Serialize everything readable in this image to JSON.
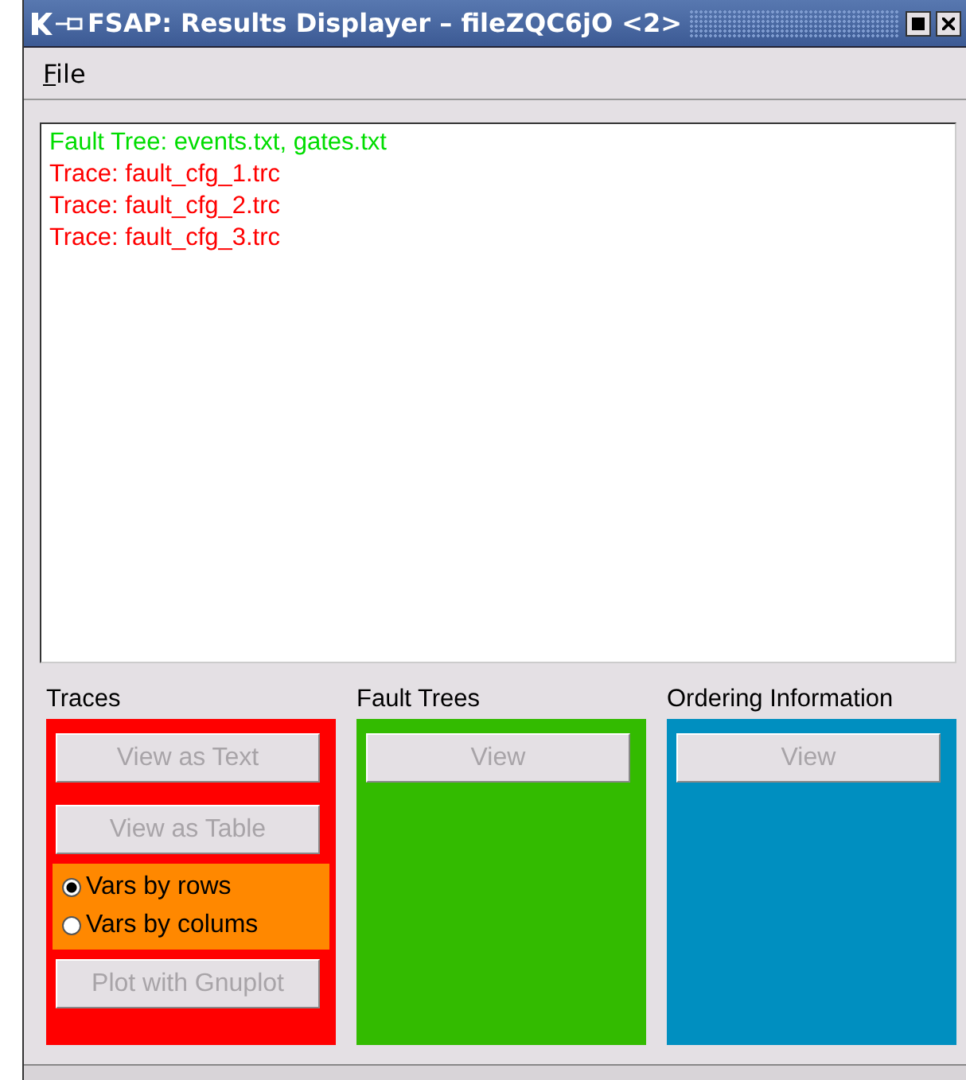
{
  "window": {
    "title": "FSAP: Results Displayer – fileZQC6jO <2>"
  },
  "menu": [
    {
      "label": "File"
    }
  ],
  "results": [
    {
      "text": "Fault Tree: events.txt, gates.txt",
      "color": "#00dd00"
    },
    {
      "text": "Trace: fault_cfg_1.trc",
      "color": "#ff0000"
    },
    {
      "text": "Trace: fault_cfg_2.trc",
      "color": "#ff0000"
    },
    {
      "text": "Trace: fault_cfg_3.trc",
      "color": "#ff0000"
    }
  ],
  "panels": [
    {
      "title": "Traces",
      "color": "#ff0000",
      "items": [
        {
          "kind": "button",
          "label": "View as Text",
          "disabled": true
        },
        {
          "kind": "button",
          "label": "View as Table",
          "disabled": true
        },
        {
          "kind": "radios",
          "color": "#ff8800",
          "options": [
            {
              "label": "Vars by rows",
              "selected": true
            },
            {
              "label": "Vars by colums",
              "selected": false
            }
          ]
        },
        {
          "kind": "button",
          "label": "Plot with Gnuplot",
          "disabled": true
        }
      ]
    },
    {
      "title": "Fault Trees",
      "color": "#33bb00",
      "items": [
        {
          "kind": "button",
          "label": "View",
          "disabled": true
        }
      ]
    },
    {
      "title": "Ordering Information",
      "color": "#008fc0",
      "items": [
        {
          "kind": "button",
          "label": "View",
          "disabled": true
        }
      ]
    }
  ]
}
